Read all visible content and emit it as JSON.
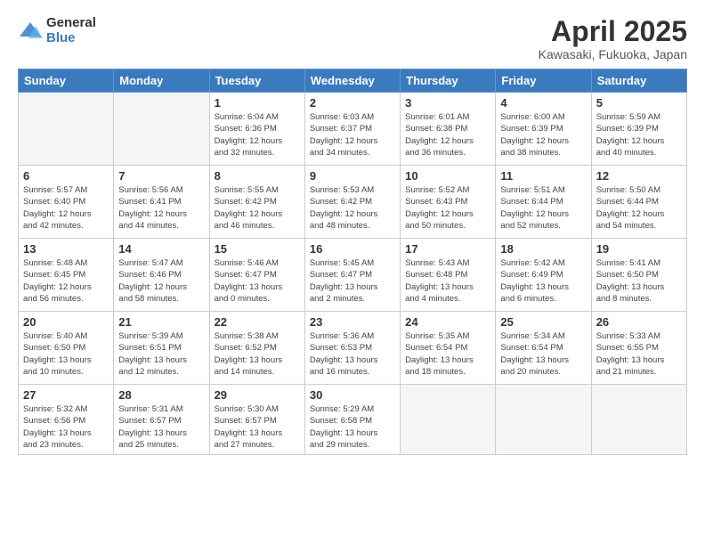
{
  "logo": {
    "general": "General",
    "blue": "Blue"
  },
  "title": "April 2025",
  "subtitle": "Kawasaki, Fukuoka, Japan",
  "weekdays": [
    "Sunday",
    "Monday",
    "Tuesday",
    "Wednesday",
    "Thursday",
    "Friday",
    "Saturday"
  ],
  "weeks": [
    [
      {
        "day": "",
        "info": ""
      },
      {
        "day": "",
        "info": ""
      },
      {
        "day": "1",
        "info": "Sunrise: 6:04 AM\nSunset: 6:36 PM\nDaylight: 12 hours\nand 32 minutes."
      },
      {
        "day": "2",
        "info": "Sunrise: 6:03 AM\nSunset: 6:37 PM\nDaylight: 12 hours\nand 34 minutes."
      },
      {
        "day": "3",
        "info": "Sunrise: 6:01 AM\nSunset: 6:38 PM\nDaylight: 12 hours\nand 36 minutes."
      },
      {
        "day": "4",
        "info": "Sunrise: 6:00 AM\nSunset: 6:39 PM\nDaylight: 12 hours\nand 38 minutes."
      },
      {
        "day": "5",
        "info": "Sunrise: 5:59 AM\nSunset: 6:39 PM\nDaylight: 12 hours\nand 40 minutes."
      }
    ],
    [
      {
        "day": "6",
        "info": "Sunrise: 5:57 AM\nSunset: 6:40 PM\nDaylight: 12 hours\nand 42 minutes."
      },
      {
        "day": "7",
        "info": "Sunrise: 5:56 AM\nSunset: 6:41 PM\nDaylight: 12 hours\nand 44 minutes."
      },
      {
        "day": "8",
        "info": "Sunrise: 5:55 AM\nSunset: 6:42 PM\nDaylight: 12 hours\nand 46 minutes."
      },
      {
        "day": "9",
        "info": "Sunrise: 5:53 AM\nSunset: 6:42 PM\nDaylight: 12 hours\nand 48 minutes."
      },
      {
        "day": "10",
        "info": "Sunrise: 5:52 AM\nSunset: 6:43 PM\nDaylight: 12 hours\nand 50 minutes."
      },
      {
        "day": "11",
        "info": "Sunrise: 5:51 AM\nSunset: 6:44 PM\nDaylight: 12 hours\nand 52 minutes."
      },
      {
        "day": "12",
        "info": "Sunrise: 5:50 AM\nSunset: 6:44 PM\nDaylight: 12 hours\nand 54 minutes."
      }
    ],
    [
      {
        "day": "13",
        "info": "Sunrise: 5:48 AM\nSunset: 6:45 PM\nDaylight: 12 hours\nand 56 minutes."
      },
      {
        "day": "14",
        "info": "Sunrise: 5:47 AM\nSunset: 6:46 PM\nDaylight: 12 hours\nand 58 minutes."
      },
      {
        "day": "15",
        "info": "Sunrise: 5:46 AM\nSunset: 6:47 PM\nDaylight: 13 hours\nand 0 minutes."
      },
      {
        "day": "16",
        "info": "Sunrise: 5:45 AM\nSunset: 6:47 PM\nDaylight: 13 hours\nand 2 minutes."
      },
      {
        "day": "17",
        "info": "Sunrise: 5:43 AM\nSunset: 6:48 PM\nDaylight: 13 hours\nand 4 minutes."
      },
      {
        "day": "18",
        "info": "Sunrise: 5:42 AM\nSunset: 6:49 PM\nDaylight: 13 hours\nand 6 minutes."
      },
      {
        "day": "19",
        "info": "Sunrise: 5:41 AM\nSunset: 6:50 PM\nDaylight: 13 hours\nand 8 minutes."
      }
    ],
    [
      {
        "day": "20",
        "info": "Sunrise: 5:40 AM\nSunset: 6:50 PM\nDaylight: 13 hours\nand 10 minutes."
      },
      {
        "day": "21",
        "info": "Sunrise: 5:39 AM\nSunset: 6:51 PM\nDaylight: 13 hours\nand 12 minutes."
      },
      {
        "day": "22",
        "info": "Sunrise: 5:38 AM\nSunset: 6:52 PM\nDaylight: 13 hours\nand 14 minutes."
      },
      {
        "day": "23",
        "info": "Sunrise: 5:36 AM\nSunset: 6:53 PM\nDaylight: 13 hours\nand 16 minutes."
      },
      {
        "day": "24",
        "info": "Sunrise: 5:35 AM\nSunset: 6:54 PM\nDaylight: 13 hours\nand 18 minutes."
      },
      {
        "day": "25",
        "info": "Sunrise: 5:34 AM\nSunset: 6:54 PM\nDaylight: 13 hours\nand 20 minutes."
      },
      {
        "day": "26",
        "info": "Sunrise: 5:33 AM\nSunset: 6:55 PM\nDaylight: 13 hours\nand 21 minutes."
      }
    ],
    [
      {
        "day": "27",
        "info": "Sunrise: 5:32 AM\nSunset: 6:56 PM\nDaylight: 13 hours\nand 23 minutes."
      },
      {
        "day": "28",
        "info": "Sunrise: 5:31 AM\nSunset: 6:57 PM\nDaylight: 13 hours\nand 25 minutes."
      },
      {
        "day": "29",
        "info": "Sunrise: 5:30 AM\nSunset: 6:57 PM\nDaylight: 13 hours\nand 27 minutes."
      },
      {
        "day": "30",
        "info": "Sunrise: 5:29 AM\nSunset: 6:58 PM\nDaylight: 13 hours\nand 29 minutes."
      },
      {
        "day": "",
        "info": ""
      },
      {
        "day": "",
        "info": ""
      },
      {
        "day": "",
        "info": ""
      }
    ]
  ]
}
